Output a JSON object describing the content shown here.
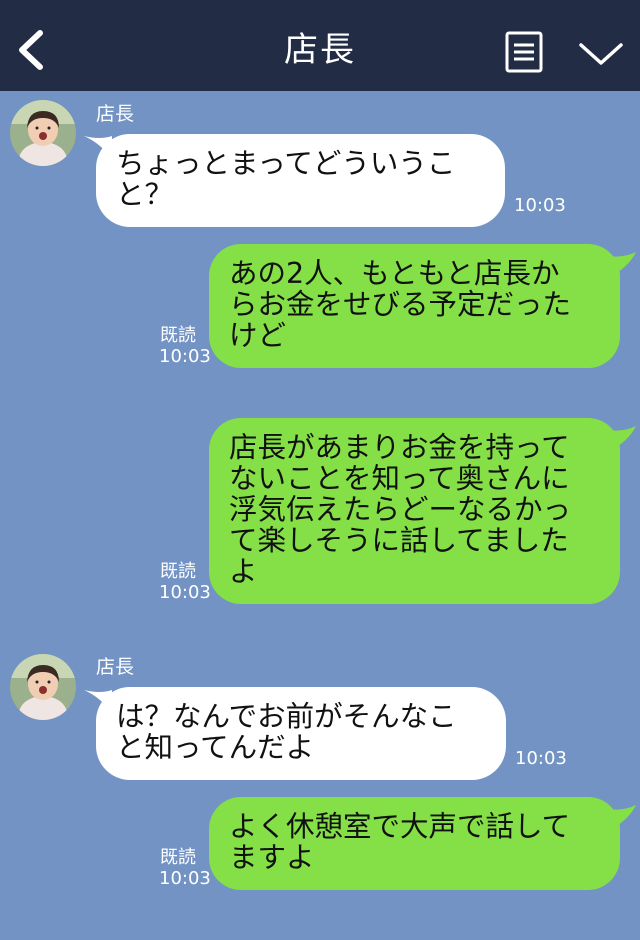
{
  "header": {
    "title": "店長",
    "back_icon": "chevron-left-icon",
    "menu_icon": "note-list-icon",
    "expand_icon": "chevron-down-icon"
  },
  "colors": {
    "header_bg": "#222c45",
    "chat_bg": "#7293c4",
    "incoming_bubble": "#ffffff",
    "outgoing_bubble": "#84e046"
  },
  "messages": [
    {
      "sender": "店長",
      "text": "ちょっとまってどういうこ\nと？",
      "time": "10:03"
    },
    {
      "text": "あの2人、もともと店長か\nらお金をせびる予定だった\nけど",
      "read": "既読",
      "time": "10:03"
    },
    {
      "text": "店長があまりお金を持って\nないことを知って奥さんに\n浮気伝えたらどーなるかっ\nて楽しそうに話してました\nよ",
      "read": "既読",
      "time": "10:03"
    },
    {
      "sender": "店長",
      "text": "は？なんでお前がそんなこ\nと知ってんだよ",
      "time": "10:03"
    },
    {
      "text": "よく休憩室で大声で話して\nますよ",
      "read": "既読",
      "time": "10:03"
    }
  ]
}
